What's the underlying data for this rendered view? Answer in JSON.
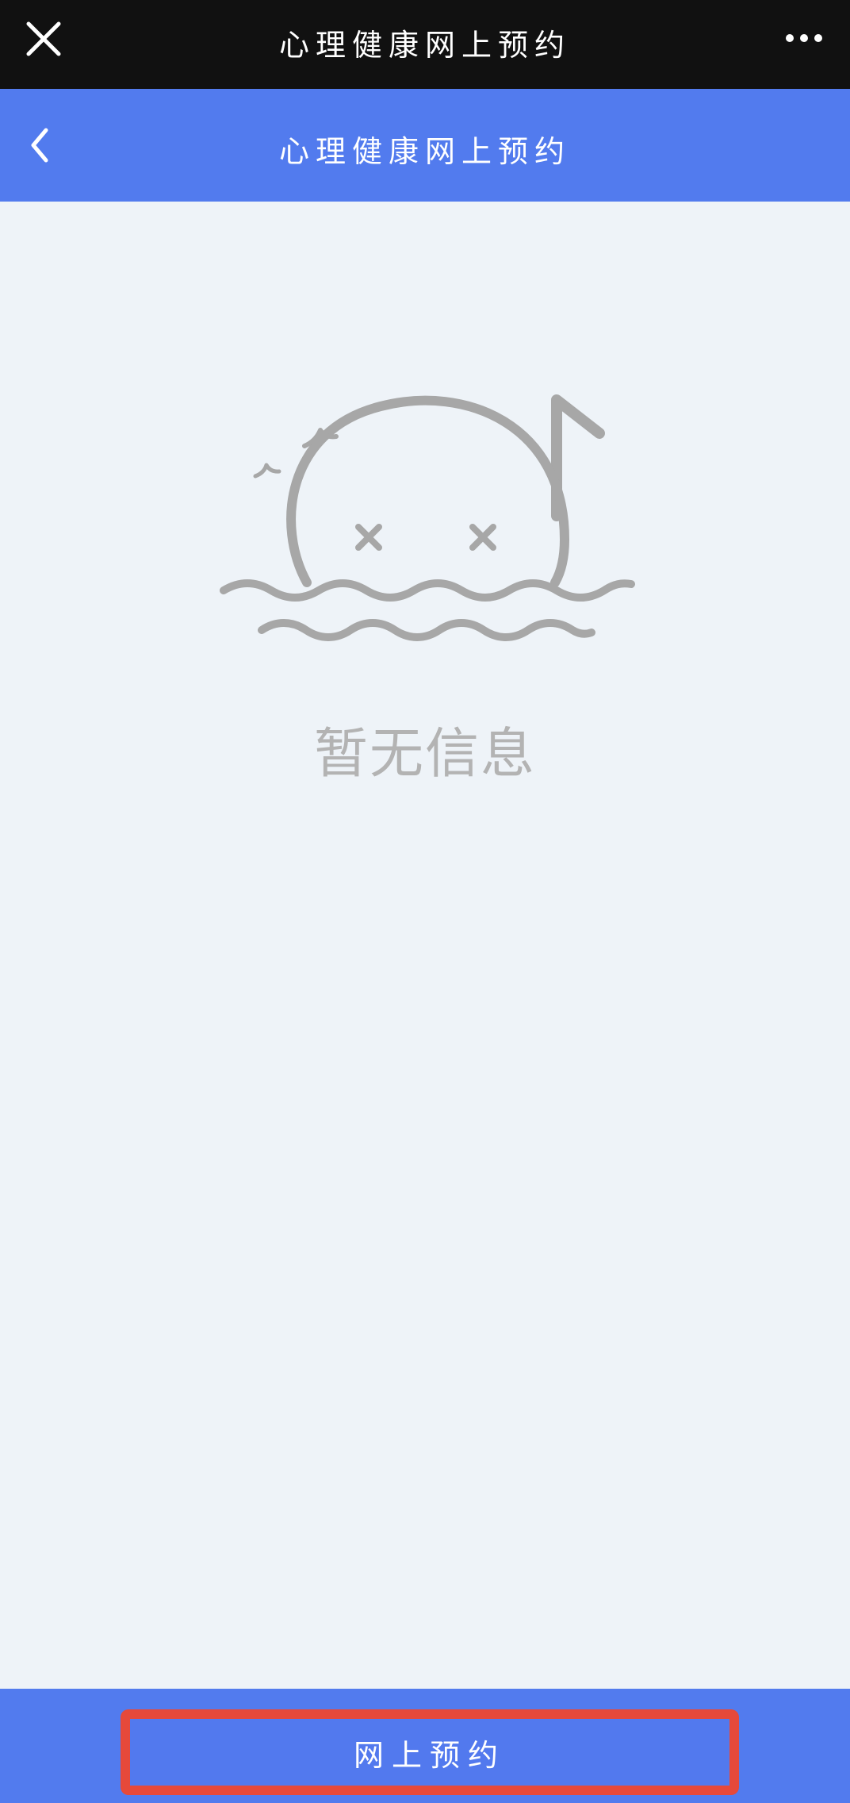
{
  "top_bar": {
    "title": "心理健康网上预约",
    "close_icon": "close-icon",
    "more_icon": "more-icon"
  },
  "nav_bar": {
    "title": "心理健康网上预约",
    "back_icon": "back-icon"
  },
  "empty_state": {
    "icon": "empty-state-illustration",
    "text": "暂无信息"
  },
  "bottom_bar": {
    "button_label": "网上预约"
  },
  "colors": {
    "top_bar": "#111111",
    "accent": "#527bee",
    "background": "#eef3f8",
    "empty_icon": "#a7a7a7",
    "empty_text": "#b3b3b3",
    "highlight_border": "#e6493a"
  }
}
